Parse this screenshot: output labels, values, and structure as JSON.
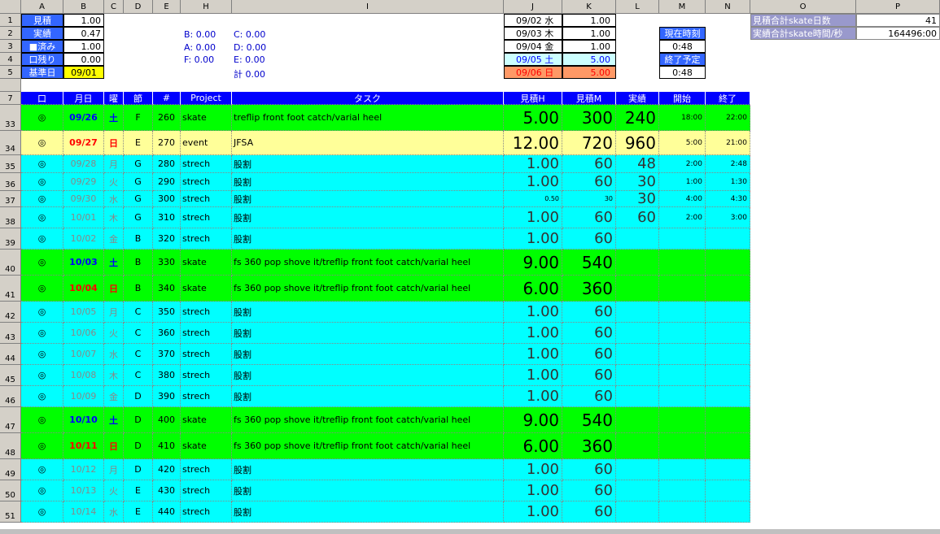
{
  "columns": [
    "A",
    "B",
    "C",
    "D",
    "E",
    "H",
    "I",
    "J",
    "K",
    "L",
    "M",
    "N",
    "O",
    "P"
  ],
  "top": {
    "rows": [
      "1",
      "2",
      "3",
      "4",
      "5",
      "7"
    ],
    "labels": {
      "mitsumori": "見積",
      "jisseki": "実績",
      "sumi": "■済み",
      "nokori": "口残り",
      "kijunbi": "基準日",
      "mitsumori_val": "1.00",
      "jisseki_val": "0.47",
      "sumi_val": "1.00",
      "nokori_val": "0.00",
      "kijunbi_val": "09/01"
    },
    "grades": {
      "b": "B: 0.00",
      "c": "C: 0.00",
      "a": "A: 0.00",
      "d": "D: 0.00",
      "f": "F: 0.00",
      "e": "E: 0.00",
      "total": "計 0.00"
    },
    "dates": [
      {
        "label": "09/02 水",
        "value": "1.00"
      },
      {
        "label": "09/03 木",
        "value": "1.00"
      },
      {
        "label": "09/04 金",
        "value": "1.00"
      },
      {
        "label": "09/05 土",
        "value": "5.00"
      },
      {
        "label": "09/06 日",
        "value": "5.00"
      }
    ],
    "time": {
      "now_label": "現在時刻",
      "now_val": "0:48",
      "end_label": "終了予定",
      "end_val": "0:48"
    },
    "summary": {
      "skate_days_label": "見積合計skate日数",
      "skate_days_val": "41",
      "skate_time_label": "実績合計skate時間/秒",
      "skate_time_val": "164496:00"
    }
  },
  "header": [
    "口",
    "月日",
    "曜",
    "節",
    "#",
    "Project",
    "タスク",
    "見積H",
    "見積M",
    "実績",
    "開始",
    "終了"
  ],
  "rows": [
    {
      "rownum": "33",
      "type": "green",
      "mark": "◎",
      "date": "09/26",
      "dow": "土",
      "sec": "F",
      "num": "260",
      "proj": "skate",
      "task": "treflip front foot catch/varial heel",
      "h": "5.00",
      "m": "300",
      "act": "240",
      "start": "18:00",
      "end": "22:00"
    },
    {
      "rownum": "34",
      "type": "yellow",
      "mark": "◎",
      "date": "09/27",
      "dow": "日",
      "sec": "E",
      "num": "270",
      "proj": "event",
      "task": "JFSA",
      "h": "12.00",
      "m": "720",
      "act": "960",
      "start": "5:00",
      "end": "21:00"
    },
    {
      "rownum": "35",
      "type": "cyan",
      "mark": "◎",
      "date": "09/28",
      "dow": "月",
      "sec": "G",
      "num": "280",
      "proj": "strech",
      "task": "股割",
      "h": "1.00",
      "m": "60",
      "act": "48",
      "start": "2:00",
      "end": "2:48"
    },
    {
      "rownum": "36",
      "type": "cyan",
      "mark": "◎",
      "date": "09/29",
      "dow": "火",
      "sec": "G",
      "num": "290",
      "proj": "strech",
      "task": "股割",
      "h": "1.00",
      "m": "60",
      "act": "30",
      "start": "1:00",
      "end": "1:30"
    },
    {
      "rownum": "37",
      "type": "cyan",
      "mark": "◎",
      "date": "09/30",
      "dow": "水",
      "sec": "G",
      "num": "300",
      "proj": "strech",
      "task": "股割",
      "h": "0.50",
      "m": "30",
      "act": "30",
      "start": "4:00",
      "end": "4:30"
    },
    {
      "rownum": "38",
      "type": "cyan",
      "mark": "◎",
      "date": "10/01",
      "dow": "木",
      "sec": "G",
      "num": "310",
      "proj": "strech",
      "task": "股割",
      "h": "1.00",
      "m": "60",
      "act": "60",
      "start": "2:00",
      "end": "3:00"
    },
    {
      "rownum": "39",
      "type": "cyan",
      "mark": "◎",
      "date": "10/02",
      "dow": "金",
      "sec": "B",
      "num": "320",
      "proj": "strech",
      "task": "股割",
      "h": "1.00",
      "m": "60",
      "act": "",
      "start": "",
      "end": ""
    },
    {
      "rownum": "40",
      "type": "green",
      "mark": "◎",
      "date": "10/03",
      "dow": "土",
      "sec": "B",
      "num": "330",
      "proj": "skate",
      "task": "fs 360 pop shove it/treflip front foot catch/varial heel",
      "h": "9.00",
      "m": "540",
      "act": "",
      "start": "",
      "end": ""
    },
    {
      "rownum": "41",
      "type": "green",
      "mark": "◎",
      "date": "10/04",
      "dow": "日",
      "sec": "B",
      "num": "340",
      "proj": "skate",
      "task": "fs 360 pop shove it/treflip front foot catch/varial heel",
      "h": "6.00",
      "m": "360",
      "act": "",
      "start": "",
      "end": ""
    },
    {
      "rownum": "42",
      "type": "cyan",
      "mark": "◎",
      "date": "10/05",
      "dow": "月",
      "sec": "C",
      "num": "350",
      "proj": "strech",
      "task": "股割",
      "h": "1.00",
      "m": "60",
      "act": "",
      "start": "",
      "end": ""
    },
    {
      "rownum": "43",
      "type": "cyan",
      "mark": "◎",
      "date": "10/06",
      "dow": "火",
      "sec": "C",
      "num": "360",
      "proj": "strech",
      "task": "股割",
      "h": "1.00",
      "m": "60",
      "act": "",
      "start": "",
      "end": ""
    },
    {
      "rownum": "44",
      "type": "cyan",
      "mark": "◎",
      "date": "10/07",
      "dow": "水",
      "sec": "C",
      "num": "370",
      "proj": "strech",
      "task": "股割",
      "h": "1.00",
      "m": "60",
      "act": "",
      "start": "",
      "end": ""
    },
    {
      "rownum": "45",
      "type": "cyan",
      "mark": "◎",
      "date": "10/08",
      "dow": "木",
      "sec": "C",
      "num": "380",
      "proj": "strech",
      "task": "股割",
      "h": "1.00",
      "m": "60",
      "act": "",
      "start": "",
      "end": ""
    },
    {
      "rownum": "46",
      "type": "cyan",
      "mark": "◎",
      "date": "10/09",
      "dow": "金",
      "sec": "D",
      "num": "390",
      "proj": "strech",
      "task": "股割",
      "h": "1.00",
      "m": "60",
      "act": "",
      "start": "",
      "end": ""
    },
    {
      "rownum": "47",
      "type": "green",
      "mark": "◎",
      "date": "10/10",
      "dow": "土",
      "sec": "D",
      "num": "400",
      "proj": "skate",
      "task": "fs 360 pop shove it/treflip front foot catch/varial heel",
      "h": "9.00",
      "m": "540",
      "act": "",
      "start": "",
      "end": ""
    },
    {
      "rownum": "48",
      "type": "green",
      "mark": "◎",
      "date": "10/11",
      "dow": "日",
      "sec": "D",
      "num": "410",
      "proj": "skate",
      "task": "fs 360 pop shove it/treflip front foot catch/varial heel",
      "h": "6.00",
      "m": "360",
      "act": "",
      "start": "",
      "end": ""
    },
    {
      "rownum": "49",
      "type": "cyan",
      "mark": "◎",
      "date": "10/12",
      "dow": "月",
      "sec": "D",
      "num": "420",
      "proj": "strech",
      "task": "股割",
      "h": "1.00",
      "m": "60",
      "act": "",
      "start": "",
      "end": ""
    },
    {
      "rownum": "50",
      "type": "cyan",
      "mark": "◎",
      "date": "10/13",
      "dow": "火",
      "sec": "E",
      "num": "430",
      "proj": "strech",
      "task": "股割",
      "h": "1.00",
      "m": "60",
      "act": "",
      "start": "",
      "end": ""
    },
    {
      "rownum": "51",
      "type": "cyan",
      "mark": "◎",
      "date": "10/14",
      "dow": "水",
      "sec": "E",
      "num": "440",
      "proj": "strech",
      "task": "股割",
      "h": "1.00",
      "m": "60",
      "act": "",
      "start": "",
      "end": ""
    }
  ],
  "colors": {
    "green": "#00ff00",
    "cyan": "#00ffff",
    "yellow": "#ffff99",
    "header_blue": "#0000ff",
    "label_blue": "#3366ff",
    "sat_bg": "#ccffff",
    "sun_bg": "#ff9966"
  }
}
